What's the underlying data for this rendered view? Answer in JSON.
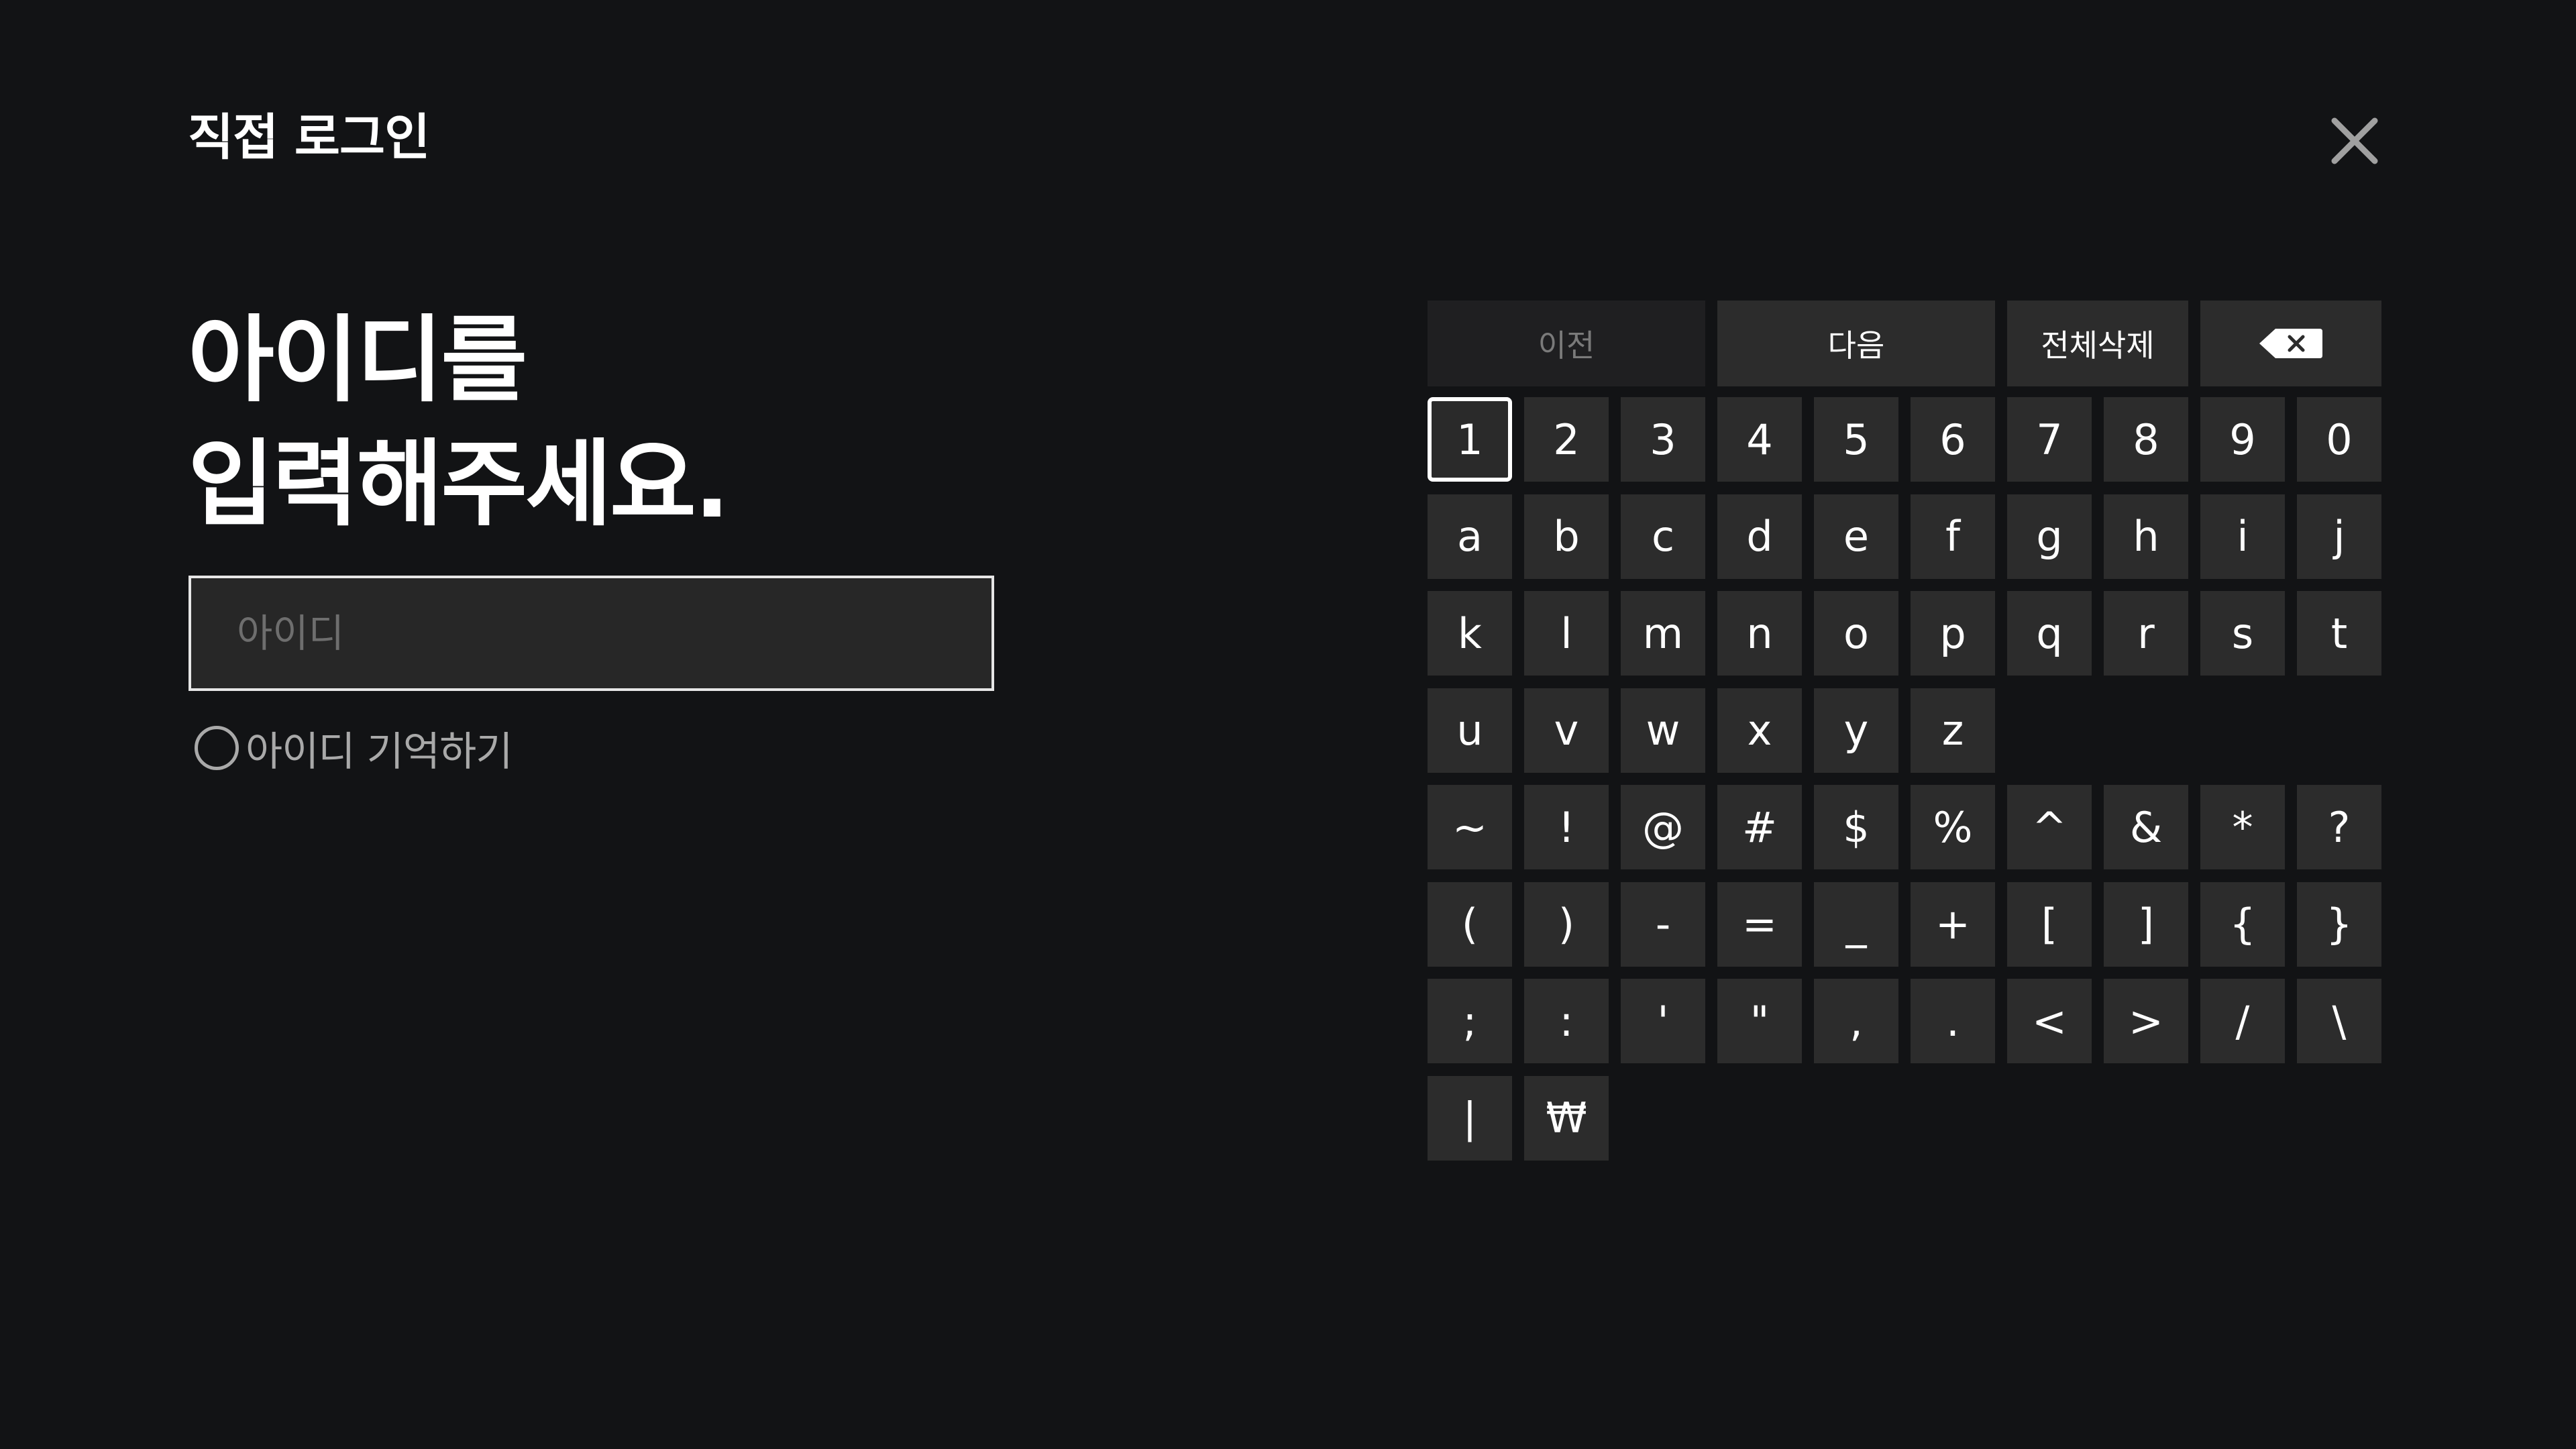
{
  "header": {
    "title": "직접 로그인"
  },
  "close": {
    "icon": "close-icon"
  },
  "prompt": {
    "line1": "아이디를",
    "line2": "입력해주세요."
  },
  "id_field": {
    "value": "",
    "placeholder": "아이디"
  },
  "remember_id": {
    "label": "아이디 기억하기",
    "checked": false
  },
  "keyboard": {
    "actions": {
      "prev": "이전",
      "next": "다음",
      "clear_all": "전체삭제",
      "backspace_icon": "backspace-icon"
    },
    "rows": [
      [
        "1",
        "2",
        "3",
        "4",
        "5",
        "6",
        "7",
        "8",
        "9",
        "0"
      ],
      [
        "a",
        "b",
        "c",
        "d",
        "e",
        "f",
        "g",
        "h",
        "i",
        "j"
      ],
      [
        "k",
        "l",
        "m",
        "n",
        "o",
        "p",
        "q",
        "r",
        "s",
        "t"
      ],
      [
        "u",
        "v",
        "w",
        "x",
        "y",
        "z"
      ],
      [
        "~",
        "!",
        "@",
        "#",
        "$",
        "%",
        "^",
        "&",
        "*",
        "?"
      ],
      [
        "(",
        ")",
        "-",
        "=",
        "_",
        "+",
        "[",
        "]",
        "{",
        "}"
      ],
      [
        ";",
        ":",
        "'",
        "\"",
        ",",
        ".",
        "<",
        ">",
        "/",
        "\\"
      ],
      [
        "|",
        "₩"
      ]
    ],
    "focused_key": "1"
  },
  "colors": {
    "background": "#121315",
    "key_background": "#2c2c2c",
    "input_border": "#e6e6e6",
    "muted_text": "#a9a9a9"
  }
}
